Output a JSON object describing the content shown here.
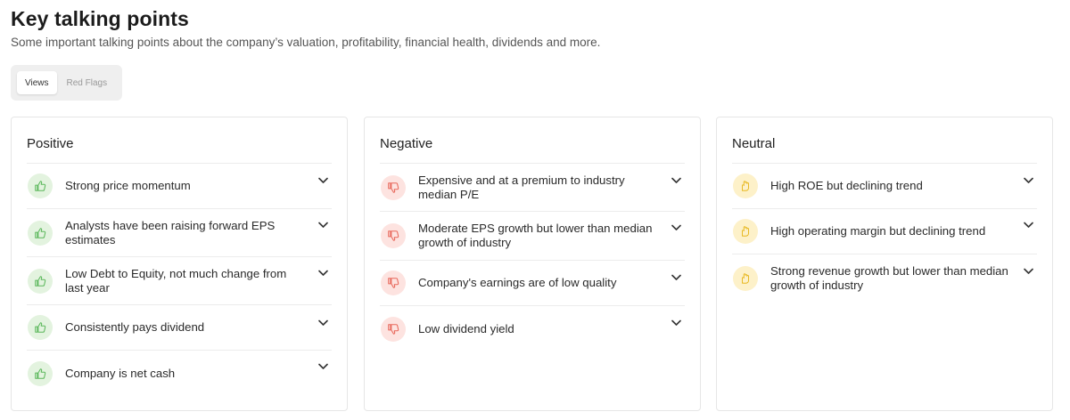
{
  "header": {
    "title": "Key talking points",
    "subtitle": "Some important talking points about the company’s valuation, profitability, financial health, dividends and more."
  },
  "tabs": [
    {
      "label": "Views",
      "active": true
    },
    {
      "label": "Red Flags",
      "active": false
    }
  ],
  "colors": {
    "positive_icon": "#5cb85c",
    "negative_icon": "#e8675a",
    "neutral_icon": "#e8b820"
  },
  "positive": {
    "title": "Positive",
    "icon": "thumbs-up-icon",
    "items": [
      {
        "label": "Strong price momentum"
      },
      {
        "label": "Analysts have been raising forward EPS estimates"
      },
      {
        "label": "Low Debt to Equity, not much change from last year"
      },
      {
        "label": "Consistently pays dividend"
      },
      {
        "label": "Company is net cash"
      }
    ]
  },
  "negative": {
    "title": "Negative",
    "icon": "thumbs-down-icon",
    "items": [
      {
        "label": "Expensive and at a premium to industry median P/E"
      },
      {
        "label": "Moderate EPS growth but lower than median growth of industry"
      },
      {
        "label": "Company's earnings are of low quality"
      },
      {
        "label": "Low dividend yield"
      }
    ]
  },
  "neutral": {
    "title": "Neutral",
    "icon": "hand-neutral-icon",
    "items": [
      {
        "label": "High ROE but declining trend"
      },
      {
        "label": "High operating margin but declining trend"
      },
      {
        "label": "Strong revenue growth but lower than median growth of industry"
      }
    ]
  }
}
